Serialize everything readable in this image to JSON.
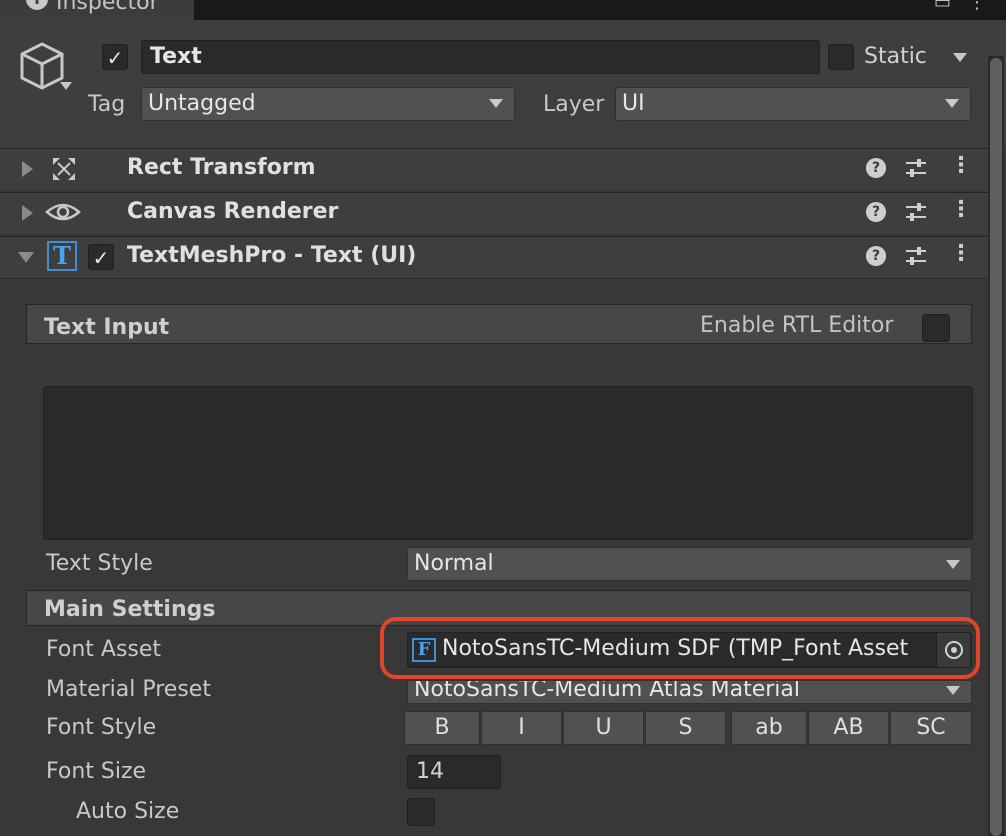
{
  "window": {
    "tab_label": "Inspector",
    "tab_icon": "info-icon"
  },
  "header": {
    "active_checked": true,
    "object_name": "Text",
    "static_label": "Static",
    "static_checked": false,
    "tag_label": "Tag",
    "tag_value": "Untagged",
    "layer_label": "Layer",
    "layer_value": "UI"
  },
  "components": [
    {
      "title": "Rect Transform",
      "icon": "rect-transform-icon",
      "expanded": false
    },
    {
      "title": "Canvas Renderer",
      "icon": "eye-icon",
      "expanded": false
    },
    {
      "title": "TextMeshPro - Text (UI)",
      "icon": "textmeshpro-icon",
      "icon_glyph": "T",
      "expanded": true,
      "enabled": true
    }
  ],
  "text_input": {
    "title": "Text Input",
    "rtl_label": "Enable RTL Editor",
    "rtl_checked": false,
    "text_value": ""
  },
  "text_style": {
    "label": "Text Style",
    "value": "Normal"
  },
  "main_settings": {
    "title": "Main Settings",
    "font_asset_label": "Font Asset",
    "font_asset_glyph": "F",
    "font_asset_value": "NotoSansTC-Medium SDF (TMP_Font Asset",
    "material_preset_label": "Material Preset",
    "material_preset_value": "NotoSansTC-Medium Atlas Material",
    "font_style_label": "Font Style",
    "font_style_buttons": [
      "B",
      "I",
      "U",
      "S",
      "ab",
      "AB",
      "SC"
    ],
    "font_size_label": "Font Size",
    "font_size_value": "14",
    "auto_size_label": "Auto Size",
    "auto_size_checked": false
  },
  "colors": {
    "highlight": "#e0452e",
    "background": "#383838"
  }
}
